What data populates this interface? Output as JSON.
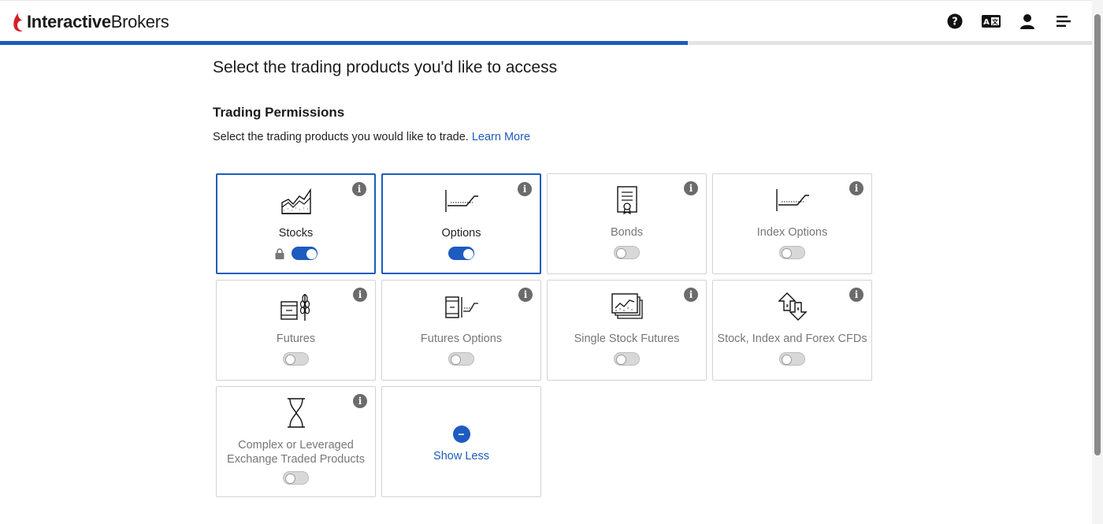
{
  "brand": {
    "name_bold": "Interactive",
    "name_regular": "Brokers",
    "color": "#d42127"
  },
  "header_icons": [
    "help-icon",
    "language-icon",
    "user-icon",
    "menu-icon"
  ],
  "progress": {
    "percent": 63,
    "color": "#1d5bbf"
  },
  "page_title": "Select the trading products you'd like to access",
  "section_title": "Trading Permissions",
  "section_subtitle": "Select the trading products you would like to trade.",
  "learn_more": "Learn More",
  "products": [
    {
      "label": "Stocks",
      "icon": "stocks-icon",
      "selected": true,
      "on": true,
      "locked": true
    },
    {
      "label": "Options",
      "icon": "options-icon",
      "selected": true,
      "on": true,
      "locked": false
    },
    {
      "label": "Bonds",
      "icon": "bonds-icon",
      "selected": false,
      "on": false,
      "locked": false
    },
    {
      "label": "Index Options",
      "icon": "index-options-icon",
      "selected": false,
      "on": false,
      "locked": false
    },
    {
      "label": "Futures",
      "icon": "futures-icon",
      "selected": false,
      "on": false,
      "locked": false
    },
    {
      "label": "Futures Options",
      "icon": "futures-options-icon",
      "selected": false,
      "on": false,
      "locked": false
    },
    {
      "label": "Single Stock Futures",
      "icon": "single-stock-futures-icon",
      "selected": false,
      "on": false,
      "locked": false
    },
    {
      "label": "Stock, Index and Forex CFDs",
      "icon": "cfds-icon",
      "selected": false,
      "on": false,
      "locked": false
    },
    {
      "label_line1": "Complex or Leveraged",
      "label_line2": "Exchange Traded Products",
      "icon": "hourglass-icon",
      "selected": false,
      "on": false,
      "locked": false
    }
  ],
  "show_less": "Show Less",
  "info_glyph": "i",
  "minus_glyph": "−"
}
